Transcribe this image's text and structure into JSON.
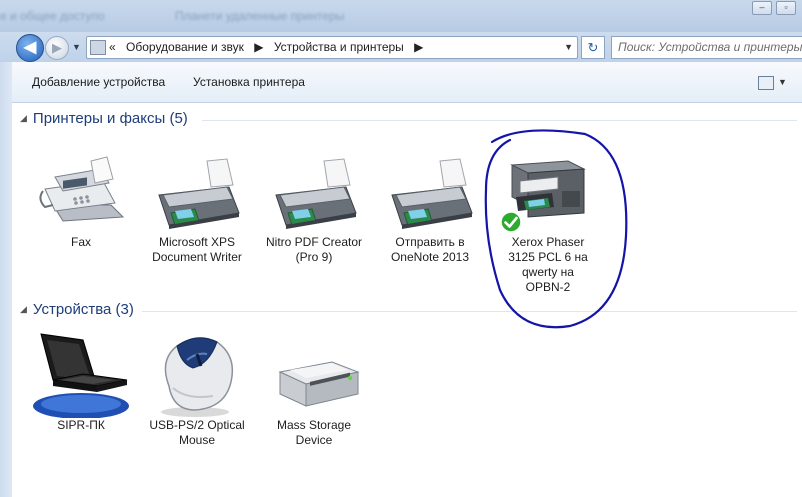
{
  "titlebar": {
    "ghost_left": "е и общее доступо",
    "ghost_mid": "Планети удаленные принтеры"
  },
  "nav": {
    "back": "◀",
    "forward": "▶",
    "breadcrumbs": [
      "Оборудование и звук",
      "Устройства и принтеры"
    ],
    "breadcrumb_prefix": "«",
    "search_placeholder": "Поиск: Устройства и принтеры",
    "refresh": "↻"
  },
  "command_bar": {
    "add_device": "Добавление устройства",
    "add_printer": "Установка принтера"
  },
  "groups": {
    "printers": {
      "title": "Принтеры и факсы (5)",
      "items": [
        {
          "label": "Fax"
        },
        {
          "label": "Microsoft XPS Document Writer"
        },
        {
          "label": "Nitro PDF Creator (Pro 9)"
        },
        {
          "label": "Отправить в OneNote 2013"
        },
        {
          "label": "Xerox Phaser 3125 PCL 6 на qwerty на OPBN-2",
          "default": true
        }
      ]
    },
    "devices": {
      "title": "Устройства (3)",
      "items": [
        {
          "label": "SIPR-ПК"
        },
        {
          "label": "USB-PS/2 Optical Mouse"
        },
        {
          "label": "Mass Storage Device"
        }
      ]
    }
  },
  "colors": {
    "annotation": "#1414a8",
    "group_title": "#1e3d79",
    "default_check": "#2eaa2e"
  }
}
